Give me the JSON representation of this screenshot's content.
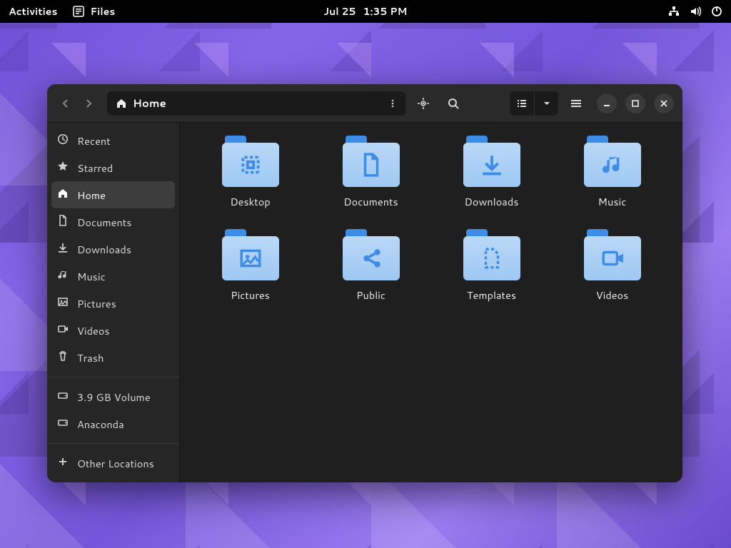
{
  "topbar": {
    "activities": "Activities",
    "app_name": "Files",
    "date": "Jul 25",
    "time": "1:35 PM"
  },
  "pathbar": {
    "location": "Home"
  },
  "sidebar": {
    "items": [
      {
        "label": "Recent",
        "icon": "clock"
      },
      {
        "label": "Starred",
        "icon": "star"
      },
      {
        "label": "Home",
        "icon": "home",
        "active": true
      },
      {
        "label": "Documents",
        "icon": "doc"
      },
      {
        "label": "Downloads",
        "icon": "down"
      },
      {
        "label": "Music",
        "icon": "music"
      },
      {
        "label": "Pictures",
        "icon": "pic"
      },
      {
        "label": "Videos",
        "icon": "vid"
      },
      {
        "label": "Trash",
        "icon": "trash"
      }
    ],
    "volumes": [
      {
        "label": "3.9 GB Volume",
        "icon": "drive"
      },
      {
        "label": "Anaconda",
        "icon": "drive"
      }
    ],
    "other": {
      "label": "Other Locations"
    }
  },
  "folders": [
    {
      "name": "Desktop",
      "glyph": "desktop"
    },
    {
      "name": "Documents",
      "glyph": "doc"
    },
    {
      "name": "Downloads",
      "glyph": "down"
    },
    {
      "name": "Music",
      "glyph": "music"
    },
    {
      "name": "Pictures",
      "glyph": "pic"
    },
    {
      "name": "Public",
      "glyph": "share"
    },
    {
      "name": "Templates",
      "glyph": "tmpl"
    },
    {
      "name": "Videos",
      "glyph": "vid"
    }
  ]
}
